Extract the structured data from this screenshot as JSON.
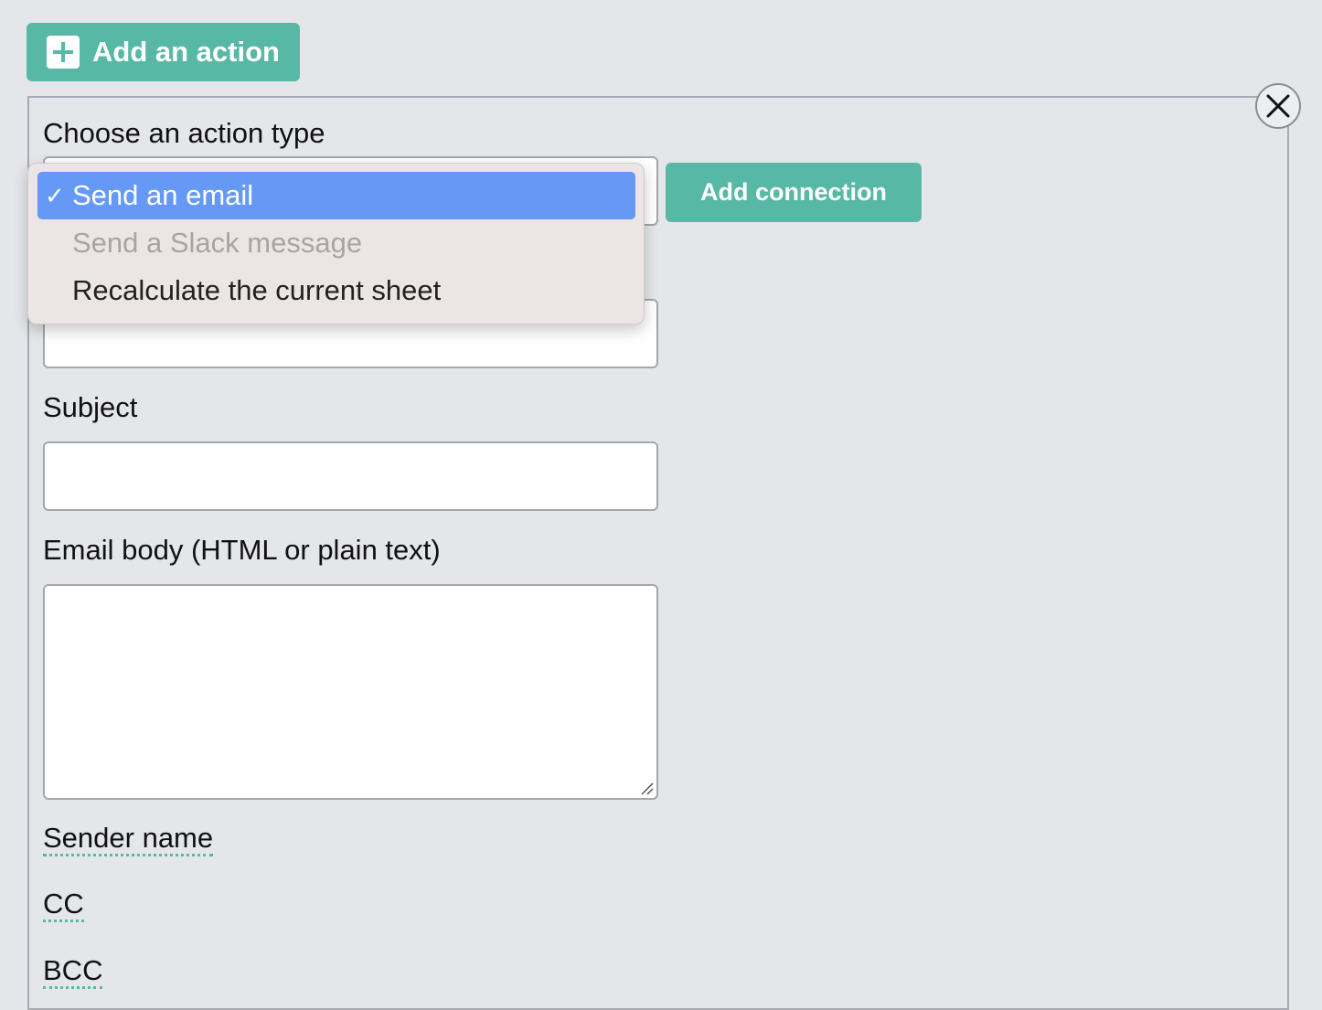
{
  "header": {
    "add_action_label": "Add an action"
  },
  "action_type": {
    "label": "Choose an action type",
    "add_connection_label": "Add connection",
    "check_glyph": "✓",
    "options": [
      {
        "label": "Send an email",
        "selected": true,
        "disabled": false
      },
      {
        "label": "Send a Slack message",
        "selected": false,
        "disabled": true
      },
      {
        "label": "Recalculate the current sheet",
        "selected": false,
        "disabled": false
      }
    ]
  },
  "fields": {
    "subject_label": "Subject",
    "body_label": "Email body (HTML or plain text)",
    "sender_name_label": "Sender name",
    "cc_label": "CC",
    "bcc_label": "BCC"
  },
  "icons": {
    "add": "plus-square-icon",
    "close": "close-icon",
    "resize": "resize-grip-icon"
  },
  "colors": {
    "accent": "#58b8a6",
    "selection": "#6699f5",
    "background": "#e5e6ea"
  }
}
